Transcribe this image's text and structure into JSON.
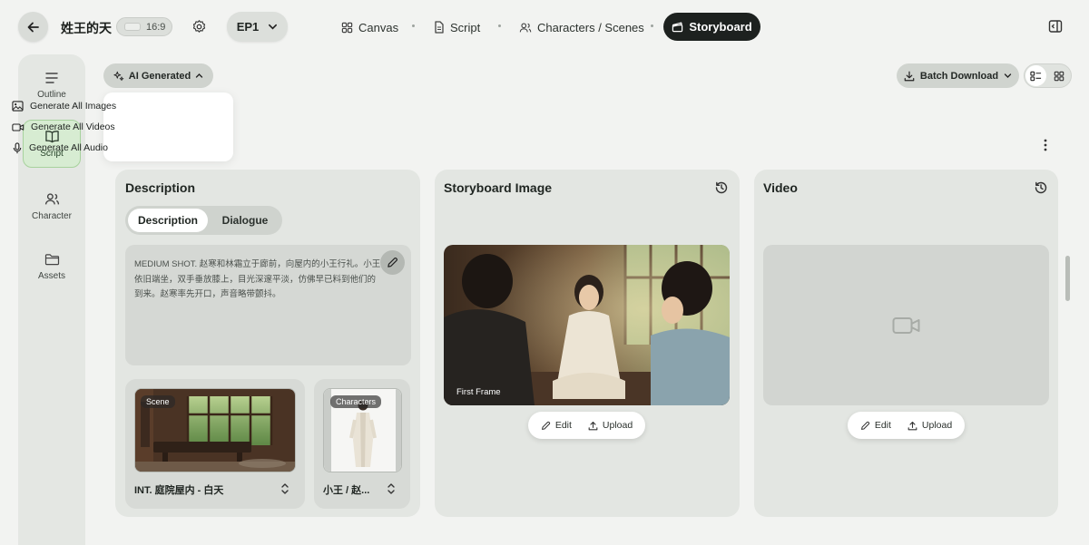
{
  "header": {
    "project_title": "姓王的天",
    "aspect_ratio": "16:9",
    "episode": "EP1",
    "tabs": [
      {
        "label": "Canvas"
      },
      {
        "label": "Script"
      },
      {
        "label": "Characters / Scenes"
      },
      {
        "label": "Storyboard"
      }
    ]
  },
  "sidebar": {
    "items": [
      {
        "label": "Outline",
        "icon": "list-icon"
      },
      {
        "label": "Script",
        "icon": "book-icon"
      },
      {
        "label": "Character",
        "icon": "users-icon"
      },
      {
        "label": "Assets",
        "icon": "folder-icon"
      }
    ]
  },
  "toolbar": {
    "ai_label": "AI Generated",
    "menu": [
      "Generate All Images",
      "Generate All Videos",
      "Generate All Audio"
    ],
    "batch_label": "Batch Download"
  },
  "description_card": {
    "title": "Description",
    "tabs": [
      "Description",
      "Dialogue"
    ],
    "text": "MEDIUM SHOT. 赵寒和林霜立于廊前，向屋内的小王行礼。小王依旧端坐，双手垂放膝上，目光深邃平淡，仿佛早已料到他们的到来。赵寒率先开口，声音略带颤抖。",
    "scene_tag": "Scene",
    "scene_label": "INT. 庭院屋内 - 白天",
    "characters_tag": "Characters",
    "characters_label": "小王 / 赵..."
  },
  "storyboard_card": {
    "title": "Storyboard Image",
    "frame_label": "First Frame",
    "edit": "Edit",
    "upload": "Upload"
  },
  "video_card": {
    "title": "Video",
    "edit": "Edit",
    "upload": "Upload"
  },
  "colors": {
    "accent_active": "#1d211f",
    "sidebar_active_bg": "#d7ecd2",
    "sidebar_active_border": "#a7d29d"
  }
}
